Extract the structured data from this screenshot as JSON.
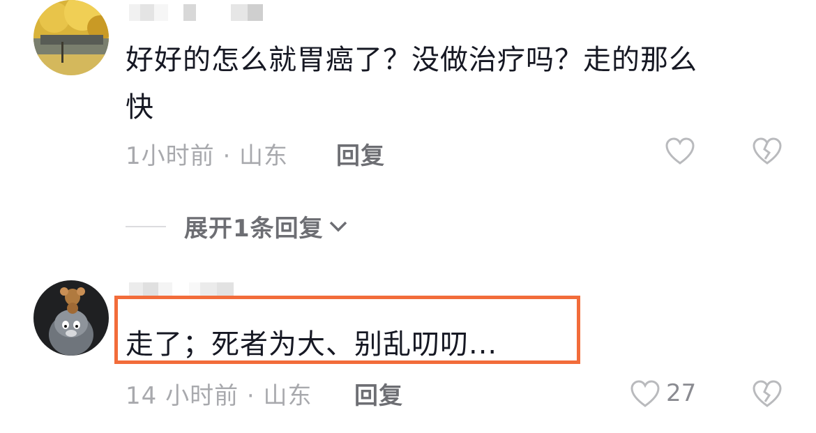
{
  "comments": [
    {
      "text_line1": "好好的怎么就胃癌了？没做治疗吗？走的那么",
      "text_line2": "快",
      "time_location": "1小时前 · 山东",
      "reply_label": "回复",
      "like_icon": "heart-outline-icon",
      "dislike_icon": "broken-heart-icon"
    },
    {
      "text": "走了；死者为大、别乱叨叨...",
      "time_location": "14 小时前 · 山东",
      "reply_label": "回复",
      "like_count": "27",
      "like_icon": "heart-outline-icon",
      "dislike_icon": "broken-heart-icon"
    }
  ],
  "expand_replies": {
    "label": "展开1条回复",
    "icon": "chevron-down-icon"
  },
  "colors": {
    "highlight_border": "#f26c3a",
    "text_primary": "#161823",
    "text_secondary": "#a8a9ad",
    "reply": "#6d6e73"
  }
}
